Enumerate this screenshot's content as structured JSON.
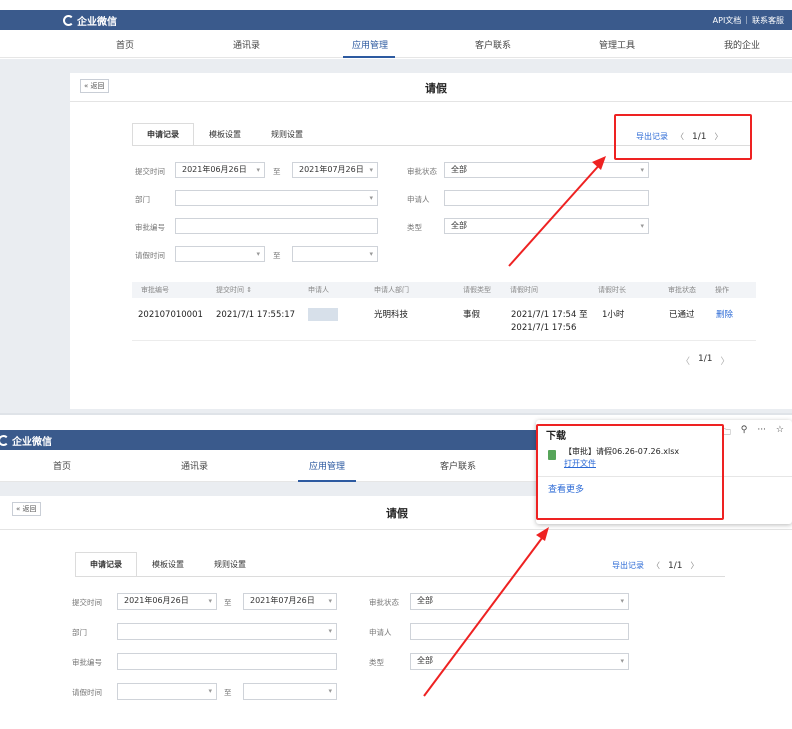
{
  "app": {
    "logo": "企业微信"
  },
  "header_links": {
    "api": "API文档",
    "sep": "|",
    "contact": "联系客服"
  },
  "nav": [
    {
      "label": "首页"
    },
    {
      "label": "通讯录"
    },
    {
      "label": "应用管理"
    },
    {
      "label": "客户联系"
    },
    {
      "label": "管理工具"
    },
    {
      "label": "我的企业"
    }
  ],
  "page": {
    "back": "« 返回",
    "title": "请假"
  },
  "tabs": [
    {
      "label": "申请记录"
    },
    {
      "label": "模板设置"
    },
    {
      "label": "规则设置"
    }
  ],
  "export": {
    "link": "导出记录",
    "prev": "〈",
    "page": "1/1",
    "next": "〉"
  },
  "filters": {
    "submit_time_label": "提交时间",
    "submit_from": "2021年06月26日",
    "to": "至",
    "submit_to": "2021年07月26日",
    "approval_status_label": "审批状态",
    "approval_status_value": "全部",
    "department_label": "部门",
    "department_value": "",
    "applicant_label": "申请人",
    "applicant_value": "",
    "approval_no_label": "审批编号",
    "approval_no_value": "",
    "type_label": "类型",
    "type_value": "全部",
    "leave_time_label": "请假时间",
    "leave_from": "",
    "leave_to": ""
  },
  "arrow_glyph": "▾",
  "table": {
    "headers": [
      "审批编号",
      "提交时间 ⇕",
      "申请人",
      "申请人部门",
      "请假类型",
      "请假时间",
      "请假时长",
      "审批状态",
      "操作"
    ],
    "rows": [
      {
        "no": "202107010001",
        "submit": "2021/7/1 17:55:17",
        "applicant": "",
        "dept": "光明科技",
        "type": "事假",
        "time_start": "2021/7/1 17:54 至",
        "time_end": "2021/7/1 17:56",
        "duration": "1小时",
        "status": "已通过",
        "action": "删除"
      }
    ]
  },
  "pager": {
    "prev": "〈",
    "page": "1/1",
    "next": "〉"
  },
  "download": {
    "title": "下载",
    "folder_icon": "🗀",
    "search_icon": "⚲",
    "more_icon": "···",
    "pin_icon": "☆",
    "file_name": "【审批】请假06.26-07.26.xlsx",
    "open": "打开文件",
    "see_more": "查看更多"
  },
  "colors": {
    "brand": "#3a5a8c",
    "link": "#2d6bd6",
    "highlight": "#ee2222"
  }
}
